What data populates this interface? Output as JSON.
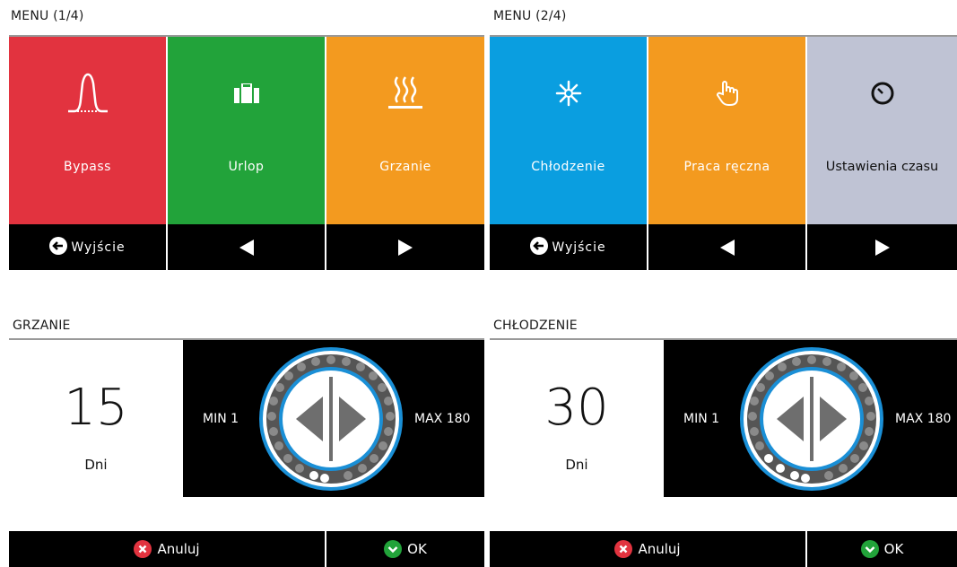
{
  "menu1": {
    "title": "MENU (1/4)",
    "tiles": [
      {
        "label": "Bypass",
        "icon": "bypass-icon",
        "color": "#e2333f"
      },
      {
        "label": "Urlop",
        "icon": "suitcase-icon",
        "color": "#22a33a"
      },
      {
        "label": "Grzanie",
        "icon": "heating-icon",
        "color": "#f39a1f"
      }
    ],
    "exit_label": "Wyjście"
  },
  "menu2": {
    "title": "MENU (2/4)",
    "tiles": [
      {
        "label": "Chłodzenie",
        "icon": "snowflake-icon",
        "color": "#0a9ee0"
      },
      {
        "label": "Praca ręczna",
        "icon": "hand-icon",
        "color": "#f39a1f"
      },
      {
        "label": "Ustawienia czasu",
        "icon": "clock-icon",
        "color": "#bfc3d4"
      }
    ],
    "exit_label": "Wyjście"
  },
  "grzanie": {
    "title": "GRZANIE",
    "value": "15",
    "unit": "Dni",
    "min": "MIN 1",
    "max": "MAX 180",
    "cancel_label": "Anuluj",
    "ok_label": "OK"
  },
  "chlodzenie": {
    "title": "CHŁODZENIE",
    "value": "30",
    "unit": "Dni",
    "min": "MIN 1",
    "max": "MAX 180",
    "cancel_label": "Anuluj",
    "ok_label": "OK"
  },
  "colors": {
    "dial_ring": "#1a8fd6",
    "cancel": "#e2333f",
    "ok": "#22a33a"
  }
}
